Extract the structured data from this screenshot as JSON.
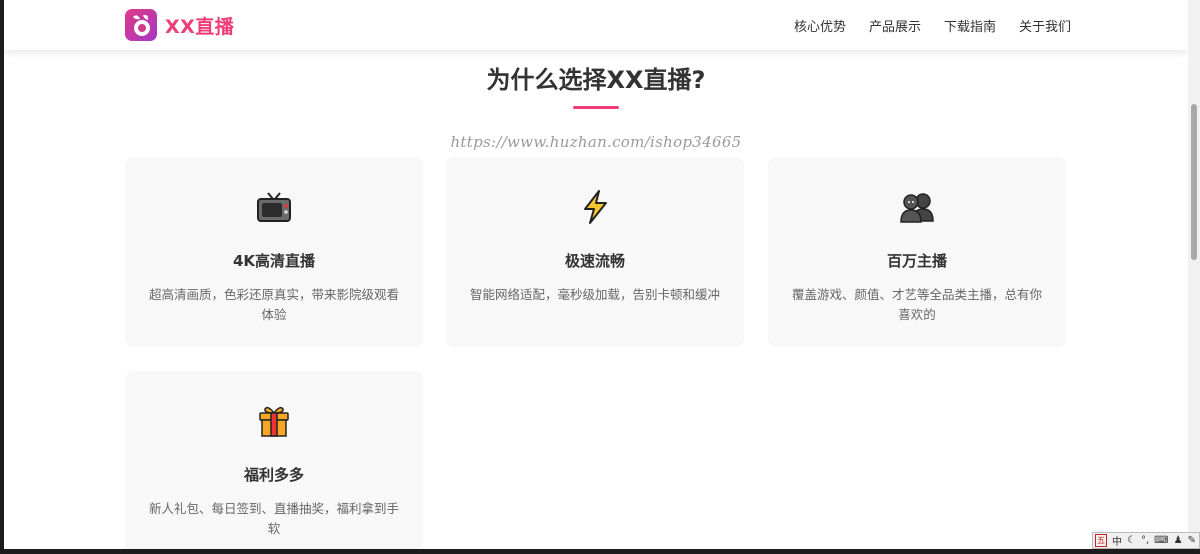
{
  "brand": {
    "name": "XX直播",
    "colors": {
      "accent": "#ee3d78",
      "logo_gradient_start": "#e23a86",
      "logo_gradient_end": "#a437c4"
    }
  },
  "nav": {
    "items": [
      "核心优势",
      "产品展示",
      "下载指南",
      "关于我们"
    ]
  },
  "section": {
    "title": "为什么选择XX直播?",
    "watermark": "https://www.huzhan.com/ishop34665"
  },
  "features": [
    {
      "icon": "tv-icon",
      "title": "4K高清直播",
      "desc": "超高清画质，色彩还原真实，带来影院级观看体验"
    },
    {
      "icon": "lightning-icon",
      "title": "极速流畅",
      "desc": "智能网络适配，毫秒级加载，告别卡顿和缓冲"
    },
    {
      "icon": "people-icon",
      "title": "百万主播",
      "desc": "覆盖游戏、颜值、才艺等全品类主播，总有你喜欢的"
    },
    {
      "icon": "gift-icon",
      "title": "福利多多",
      "desc": "新人礼包、每日签到、直播抽奖，福利拿到手软"
    }
  ],
  "ime": {
    "label": "中",
    "logo": "五"
  }
}
